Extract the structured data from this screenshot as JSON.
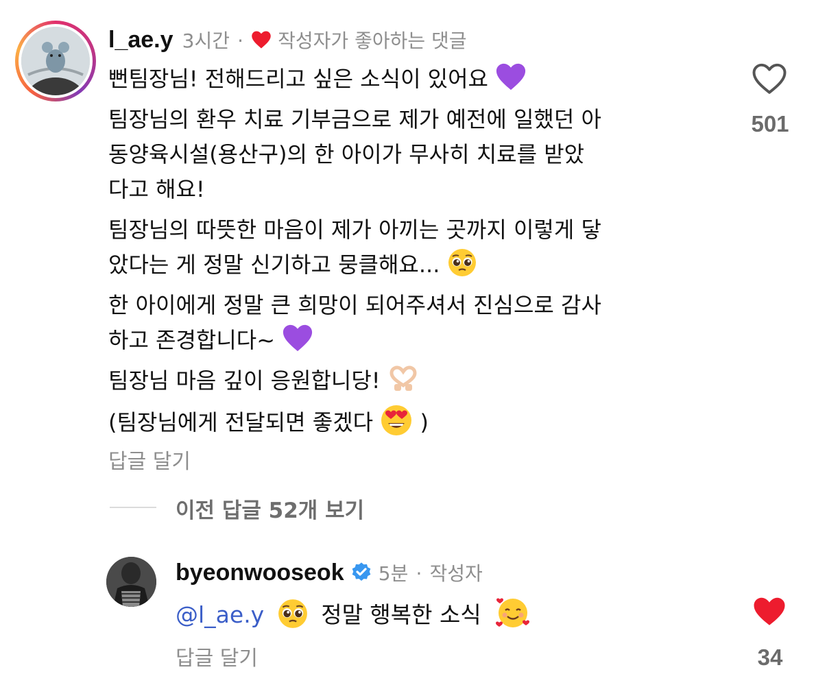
{
  "comment1": {
    "username": "l_ae.y",
    "time": "3시간",
    "separator": "·",
    "liked_by_author": "작성자가 좋아하는 댓글",
    "paragraphs": [
      [
        "뻔팀장님! 전해드리고 싶은 소식이 있어요"
      ],
      [
        "팀장님의 환우 치료 기부금으로 제가 예전에 일했던 아",
        "동양육시설(용산구)의 한 아이가 무사히 치료를 받았",
        "다고 해요!"
      ],
      [
        "팀장님의 따뜻한 마음이 제가 아끼는 곳까지 이렇게 닿",
        "았다는 게 정말 신기하고 뭉클해요..."
      ],
      [
        "한 아이에게 정말 큰 희망이 되어주셔서 진심으로 감사",
        "하고 존경합니다~"
      ],
      [
        "팀장님 마음 깊이 응원합니당!"
      ],
      [
        "(팀장님에게 전달되면 좋겠다",
        ")"
      ]
    ],
    "reply_label": "답글 달기",
    "like_count": "501"
  },
  "view_previous": "이전 답글 52개 보기",
  "comment2": {
    "username": "byeonwooseok",
    "time": "5분",
    "separator": "·",
    "author_tag": "작성자",
    "mention": "@l_ae.y",
    "text": "정말 행복한 소식",
    "reply_label": "답글 달기",
    "like_count": "34"
  },
  "colors": {
    "heart_liked": "#ed4956",
    "verified": "#3897f0",
    "mention": "#3b5ec8",
    "muted": "#8e8e8e",
    "purple_heart": "#9b4de0"
  },
  "icons": [
    "purple-heart-icon",
    "pleading-face-icon",
    "heart-hands-icon",
    "heart-eyes-face-icon",
    "smiling-face-with-hearts-icon",
    "verified-badge-icon",
    "like-heart-outline-icon",
    "like-heart-filled-icon"
  ]
}
